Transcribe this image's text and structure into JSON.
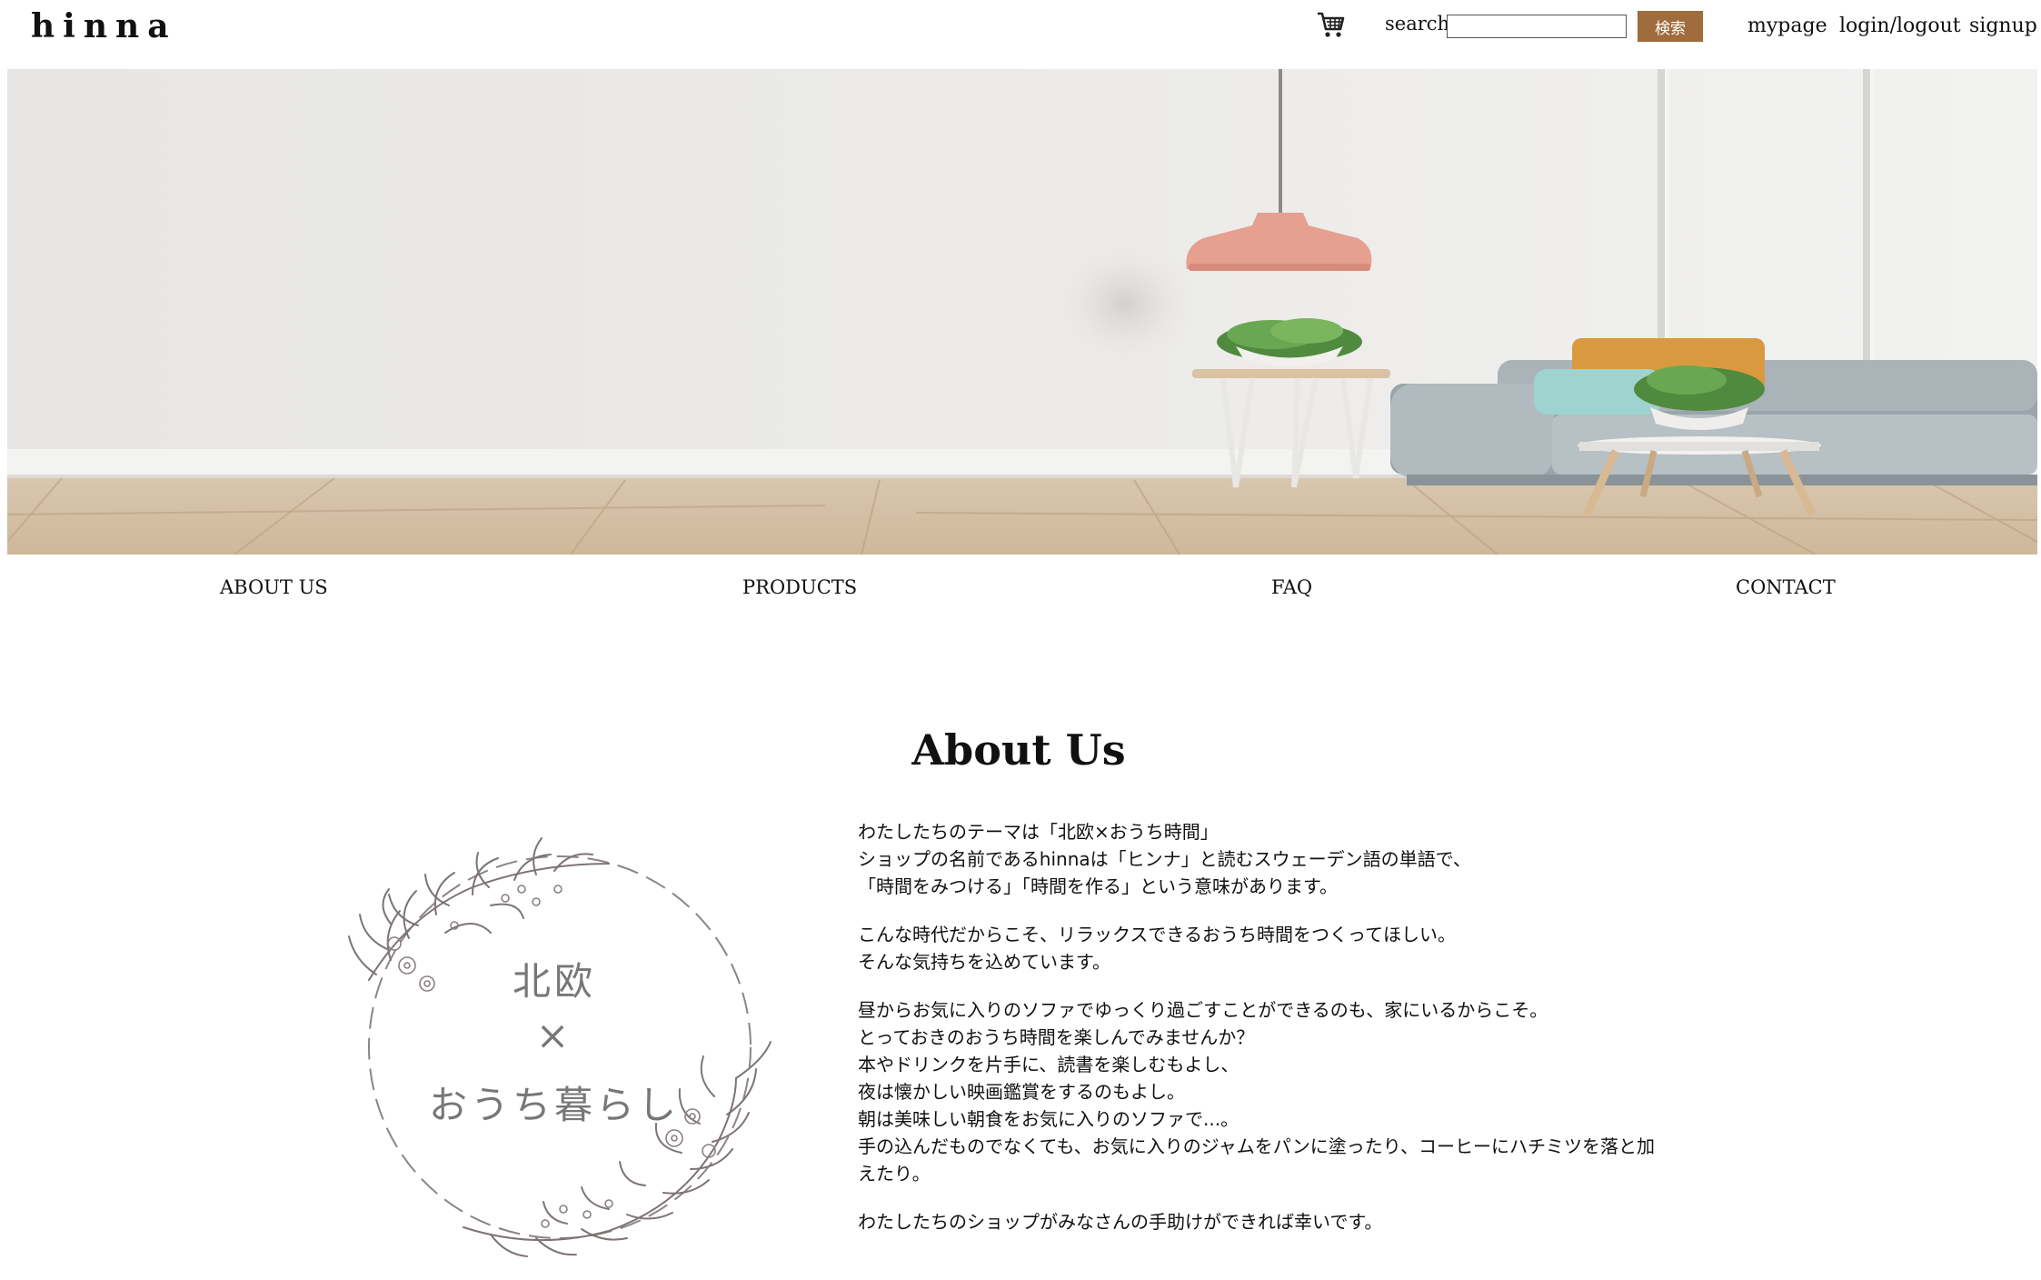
{
  "header": {
    "logo": "hinna",
    "cart_icon": "cart-icon",
    "search_label": "search:",
    "search_value": "",
    "search_button": "検索",
    "links": [
      "mypage",
      "login/logout",
      "signup"
    ]
  },
  "colors": {
    "accent": "#a06b3d",
    "lamp": "#e8a593",
    "sofa": "#9ea8ad",
    "cushion_orange": "#d99a3f",
    "cushion_teal": "#9fd3cf",
    "floor": "#d9c4a8"
  },
  "nav": [
    "ABOUT US",
    "PRODUCTS",
    "FAQ",
    "CONTACT"
  ],
  "about": {
    "title": "About Us",
    "emblem": {
      "line1": "北欧",
      "line2": "×",
      "line3": "おうち暮らし"
    },
    "paragraphs": [
      [
        "わたしたちのテーマは「北欧×おうち時間」",
        "ショップの名前であるhinnaは「ヒンナ」と読むスウェーデン語の単語で、",
        "「時間をみつける」「時間を作る」という意味があります。"
      ],
      [
        "こんな時代だからこそ、リラックスできるおうち時間をつくってほしい。",
        "そんな気持ちを込めています。"
      ],
      [
        "昼からお気に入りのソファでゆっくり過ごすことができるのも、家にいるからこそ。",
        "とっておきのおうち時間を楽しんでみませんか？",
        "本やドリンクを片手に、読書を楽しむもよし、",
        "夜は懐かしい映画鑑賞をするのもよし。",
        "朝は美味しい朝食をお気に入りのソファで...。",
        "手の込んだものでなくても、お気に入りのジャムをパンに塗ったり、コーヒーにハチミツを落と加",
        "えたり。"
      ],
      [
        "わたしたちのショップがみなさんの手助けができれば幸いです。"
      ]
    ]
  }
}
